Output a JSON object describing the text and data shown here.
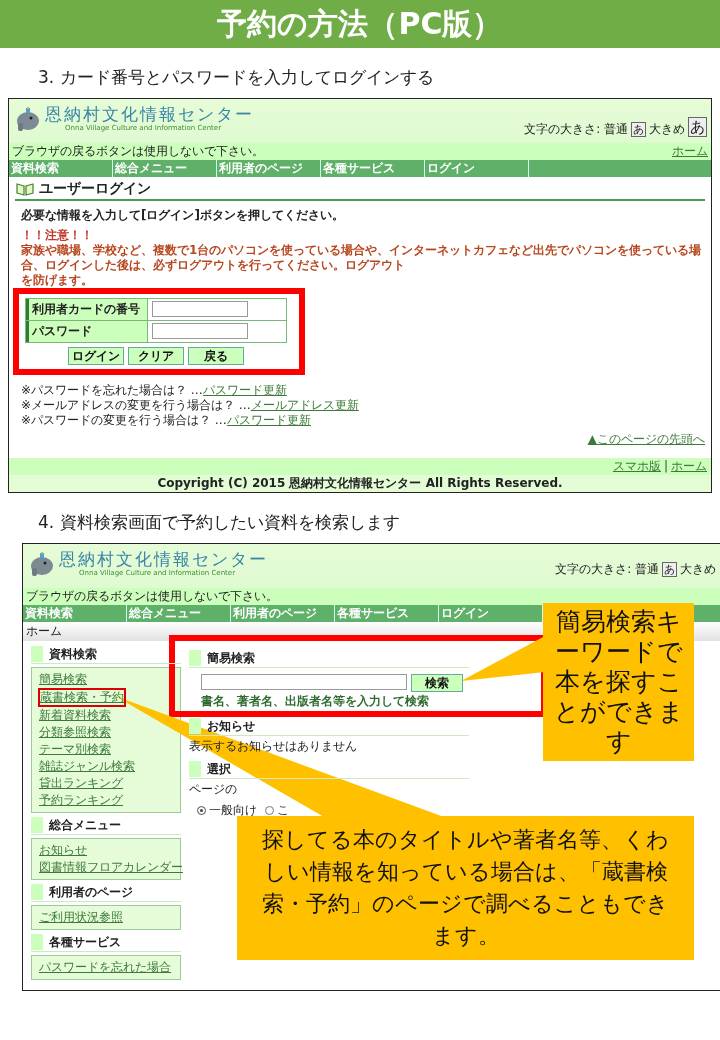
{
  "title": "予約の方法（PC版）",
  "step3": {
    "caption": "3. カード番号とパスワードを入力してログインする",
    "screen": {
      "header": {
        "site_name": "恩納村文化情報センター",
        "site_subtitle": "Onna Village Culture and Information Center",
        "size_label": "文字の大きさ: 普通",
        "size_normal": "あ",
        "size_large_label": "大きめ",
        "size_large": "あ"
      },
      "notice": {
        "text": "ブラウザの戻るボタンは使用しないで下さい。",
        "home_link": "ホーム"
      },
      "nav": [
        "資料検索",
        "総合メニュー",
        "利用者のページ",
        "各種サービス",
        "ログイン"
      ],
      "page_heading": "ユーザーログイン",
      "instruction": "必要な情報を入力して[ログイン]ボタンを押してください。",
      "warning_title": "！！注意！！",
      "warning_lines": [
        "家族や職場、学校など、複数で1台のパソコンを使っている場合や、インターネットカフェなど出先でパソコンを使っている場合、ログインした後は、必ずログアウトを行ってください。ログアウト",
        "を防げます。"
      ],
      "form_fields": [
        {
          "label": "利用者カードの番号"
        },
        {
          "label": "パスワード"
        }
      ],
      "form_buttons": [
        "ログイン",
        "クリア",
        "戻る"
      ],
      "help_links": [
        {
          "text": "※パスワードを忘れた場合は？ …",
          "link": "パスワード更新"
        },
        {
          "text": "※メールアドレスの変更を行う場合は？ …",
          "link": "メールアドレス更新"
        },
        {
          "text": "※パスワードの変更を行う場合は？ …",
          "link": "パスワード更新"
        }
      ],
      "page_top": "▲このページの先頭へ",
      "footer_links": [
        "スマホ版",
        "ホーム"
      ],
      "footer_separator": "|",
      "copyright": "Copyright (C) 2015 恩納村文化情報センター All Rights Reserved."
    }
  },
  "step4": {
    "caption": "4. 資料検索画面で予約したい資料を検索します",
    "screen": {
      "header": {
        "site_name": "恩納村文化情報センター",
        "site_subtitle": "Onna Village Culture and Information Center",
        "size_label": "文字の大きさ: 普通",
        "size_normal": "あ",
        "size_large_label": "大きめ"
      },
      "notice": {
        "text": "ブラウザの戻るボタンは使用しないで下さい。"
      },
      "nav": [
        "資料検索",
        "総合メニュー",
        "利用者のページ",
        "各種サービス",
        "ログイン"
      ],
      "breadcrumb": "ホーム",
      "sidebar": [
        {
          "heading": "資料検索",
          "items": [
            {
              "text": "簡易検索",
              "highlighted": false
            },
            {
              "text": "蔵書検索・予約",
              "highlighted": true
            },
            {
              "text": "新着資料検索",
              "highlighted": false
            },
            {
              "text": "分類参照検索",
              "highlighted": false
            },
            {
              "text": "テーマ別検索",
              "highlighted": false
            },
            {
              "text": "雑誌ジャンル検索",
              "highlighted": false
            },
            {
              "text": "貸出ランキング",
              "highlighted": false
            },
            {
              "text": "予約ランキング",
              "highlighted": false
            }
          ]
        },
        {
          "heading": "総合メニュー",
          "items": [
            {
              "text": "お知らせ",
              "highlighted": false
            },
            {
              "text": "図書情報フロアカレンダー",
              "highlighted": false
            }
          ]
        },
        {
          "heading": "利用者のページ",
          "items": [
            {
              "text": "ご利用状況参照",
              "highlighted": false
            }
          ]
        },
        {
          "heading": "各種サービス",
          "items": [
            {
              "text": "パスワードを忘れた場合",
              "highlighted": false
            }
          ]
        }
      ],
      "quick_search": {
        "heading": "簡易検索",
        "button": "検索",
        "hint": "書名、著者名、出版者名等を入力して検索"
      },
      "news": {
        "heading": "お知らせ",
        "text": "表示するお知らせはありません"
      },
      "select": {
        "heading": "選択",
        "text": "ページの",
        "options": [
          {
            "label": "一般向け",
            "selected": true
          },
          {
            "label": "こ",
            "selected": false
          }
        ]
      }
    },
    "callouts": [
      {
        "kind": "small",
        "text": "簡易検索キーワードで本を探すことができます"
      },
      {
        "kind": "large",
        "text": "探してる本のタイトルや著者名等、くわしい情報を知っている場合は、「蔵書検索・予約」のページで調べることもできます。"
      }
    ]
  }
}
